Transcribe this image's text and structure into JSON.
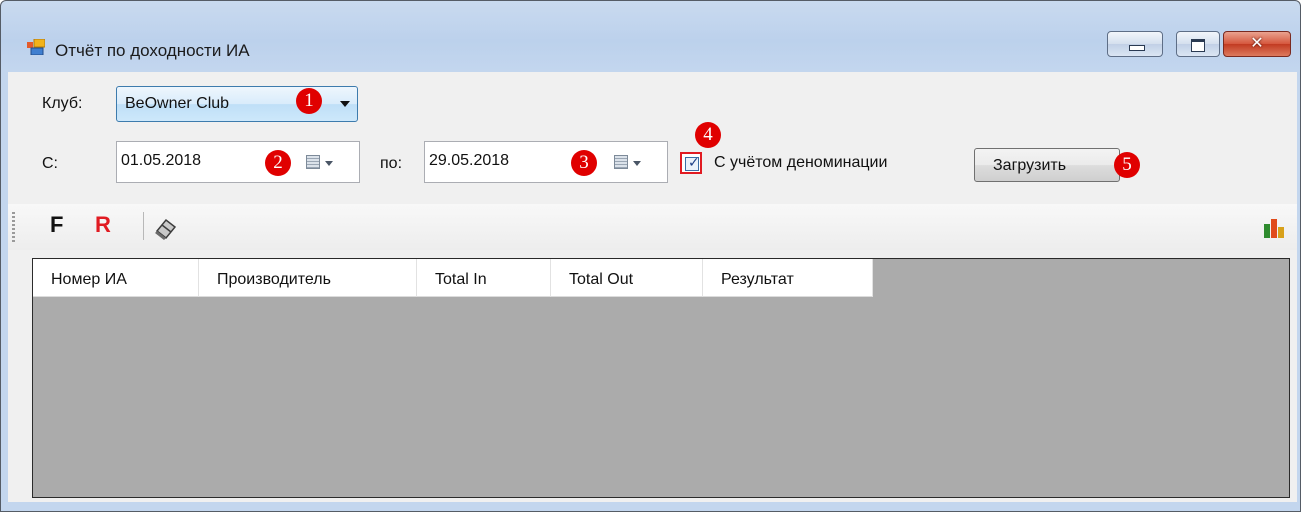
{
  "window": {
    "title": "Отчёт по доходности ИА",
    "controls": {
      "minimize_icon": "minimize-icon",
      "maximize_icon": "maximize-icon",
      "close_label": "✕"
    }
  },
  "filters": {
    "club_label": "Клуб:",
    "club_value": "BeOwner Club",
    "from_label": "С:",
    "from_date": "01.05.2018",
    "to_label": "по:",
    "to_date": "29.05.2018",
    "denomination_checkbox": {
      "label": "С учётом деноминации",
      "checked": true
    },
    "load_button": "Загрузить"
  },
  "annotations": [
    "1",
    "2",
    "3",
    "4",
    "5"
  ],
  "toolbar": {
    "f_label": "F",
    "r_label": "R",
    "icons": [
      "eraser-icon",
      "chart-icon"
    ]
  },
  "table": {
    "columns": [
      "Номер ИА",
      "Производитель",
      "Total In",
      "Total Out",
      "Результат"
    ],
    "rows": []
  },
  "colors": {
    "annotation": "#e00000",
    "r_button": "#e11b22",
    "grid_background": "#ababab"
  }
}
